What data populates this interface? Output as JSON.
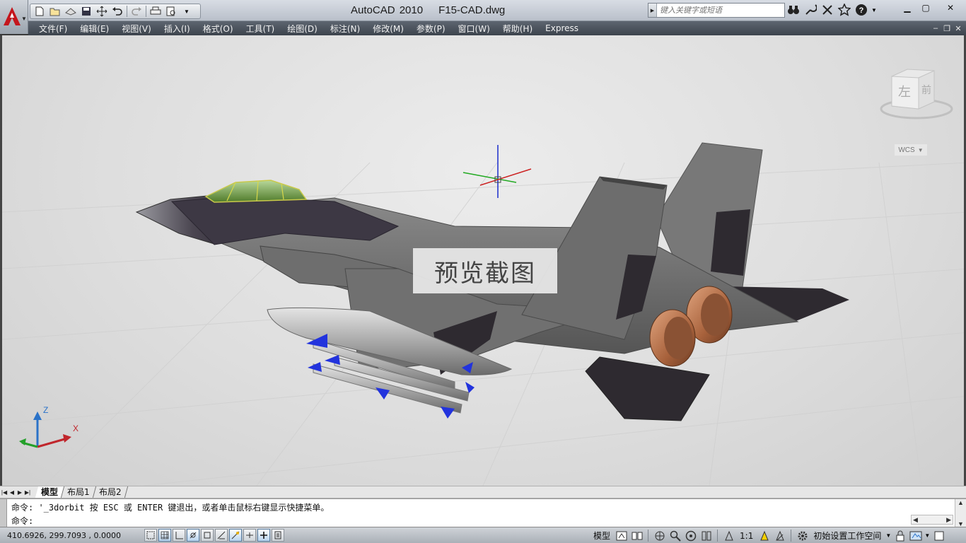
{
  "title": {
    "app_name": "AutoCAD 2010",
    "file_name": "F15-CAD.dwg"
  },
  "search": {
    "placeholder": "键入关键字或短语"
  },
  "quick_access": [
    {
      "icon": "new-file-icon"
    },
    {
      "icon": "open-file-icon"
    },
    {
      "icon": "open-web-icon"
    },
    {
      "icon": "save-icon"
    },
    {
      "icon": "pan-icon"
    },
    {
      "icon": "undo-icon"
    },
    {
      "icon": "redo-icon"
    },
    {
      "icon": "plot-icon"
    },
    {
      "icon": "plot-preview-icon"
    }
  ],
  "menu": {
    "items": [
      "文件(F)",
      "编辑(E)",
      "视图(V)",
      "插入(I)",
      "格式(O)",
      "工具(T)",
      "绘图(D)",
      "标注(N)",
      "修改(M)",
      "参数(P)",
      "窗口(W)",
      "帮助(H)",
      "Express"
    ]
  },
  "viewport": {
    "watermark": "预览截图",
    "viewcube": {
      "left_face": "左",
      "front_face": "前"
    },
    "wcs_label": "WCS",
    "ucs": {
      "x_label": "X",
      "z_label": "Z"
    },
    "colors": {
      "background": "#dedede",
      "aircraft_body": "#6a6a6a",
      "aircraft_dark": "#2e2a30",
      "canopy": "#7aa04a",
      "nozzle": "#b87a55",
      "missile_tip": "#2233dd"
    }
  },
  "layout_tabs": [
    "模型",
    "布局1",
    "布局2"
  ],
  "command": {
    "history": "命令: '_3dorbit 按 ESC 或 ENTER 键退出，或者单击鼠标右键显示快捷菜单。",
    "prompt": "命令:"
  },
  "status": {
    "coordinates": "410.6926,  299.7093 , 0.0000",
    "model_label": "模型",
    "annotation_scale": "1:1",
    "workspace": "初始设置工作空间"
  }
}
